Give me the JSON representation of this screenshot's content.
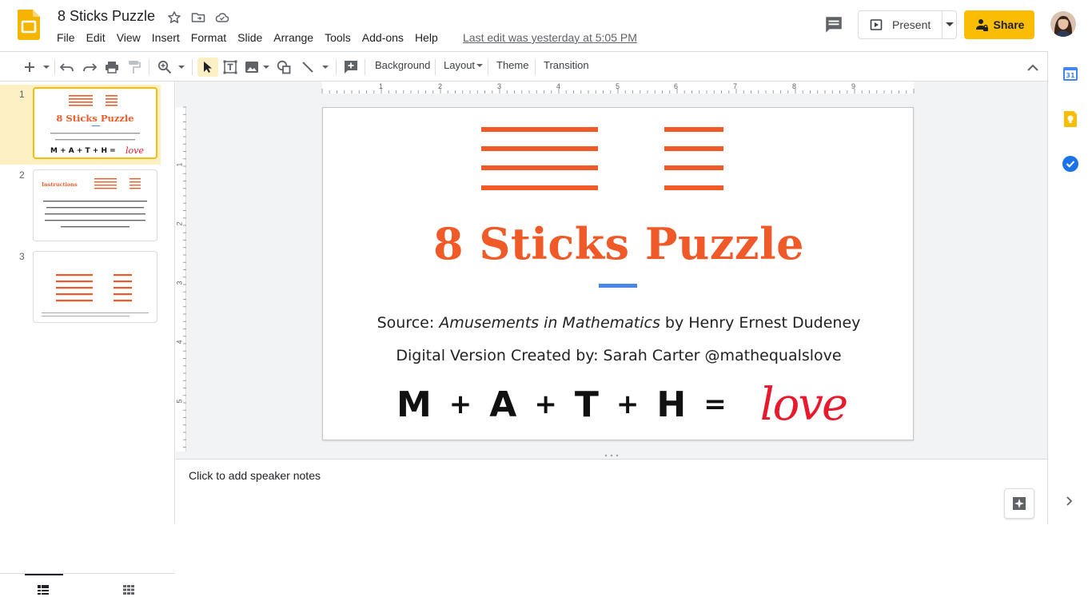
{
  "app": {
    "title": "8 Sticks Puzzle",
    "last_edit": "Last edit was yesterday at 5:05 PM"
  },
  "menu": [
    "File",
    "Edit",
    "View",
    "Insert",
    "Format",
    "Slide",
    "Arrange",
    "Tools",
    "Add-ons",
    "Help"
  ],
  "header": {
    "present_label": "Present",
    "share_label": "Share"
  },
  "toolbar": {
    "background_label": "Background",
    "layout_label": "Layout",
    "theme_label": "Theme",
    "transition_label": "Transition"
  },
  "filmstrip": {
    "slides": [
      {
        "number": "1",
        "selected": true
      },
      {
        "number": "2",
        "selected": false,
        "title": "Instructions",
        "body": "Arrange all eight sticks (four of them being exactly half the length of the others) to form three squares, all of the same size. The sticks may overlap, but there must be no loose ends hanging over."
      },
      {
        "number": "3",
        "selected": false
      }
    ]
  },
  "ruler": {
    "top_labels": [
      "1",
      "2",
      "3",
      "4",
      "5",
      "6",
      "7",
      "8",
      "9"
    ],
    "left_labels": [
      "1",
      "2",
      "3",
      "4",
      "5"
    ]
  },
  "slide": {
    "title": "8 Sticks Puzzle",
    "source_prefix": "Source: ",
    "source_book": "Amusements in Mathematics",
    "source_suffix": " by Henry Ernest Dudeney",
    "credit": "Digital Version Created by: Sarah Carter @mathequalslove",
    "math": {
      "letters": [
        "M",
        "A",
        "T",
        "H"
      ],
      "plus": "+",
      "equals": "=",
      "result": "love"
    }
  },
  "notes": {
    "placeholder": "Click to add speaker notes"
  },
  "colors": {
    "accent_orange": "#f05a28",
    "accent_blue": "#4a86e8",
    "share_yellow": "#fbbc04",
    "love_red": "#e8192c",
    "selected_thumb_bg": "#fef0c5"
  },
  "icons": {
    "logo": "slides-logo-icon",
    "star": "star-icon",
    "move": "move-to-folder-icon",
    "cloud": "cloud-saved-icon",
    "comment": "comment-icon",
    "present": "present-icon",
    "share": "lock-person-icon",
    "explore": "explore-icon"
  }
}
